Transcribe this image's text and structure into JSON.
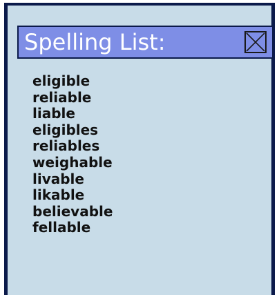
{
  "window": {
    "title": "Spelling List:",
    "close_icon": "close-x-box-icon"
  },
  "colors": {
    "panel_background": "#c8dce8",
    "panel_border": "#0b1a4a",
    "titlebar_background": "#7e8ee6",
    "title_text": "#ffffff",
    "word_text": "#111111"
  },
  "suggestions": [
    "eligible",
    "reliable",
    "liable",
    "eligibles",
    "reliables",
    "weighable",
    "livable",
    "likable",
    "believable",
    "fellable"
  ]
}
